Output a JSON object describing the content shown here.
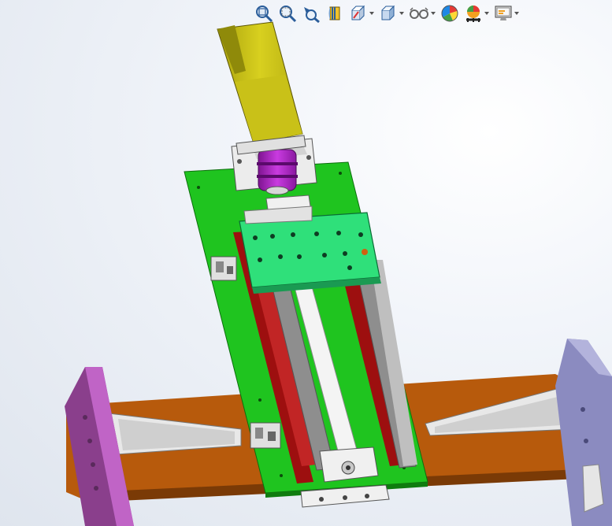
{
  "app": {
    "viewport_name": "graphics-area"
  },
  "toolbar": {
    "items": [
      {
        "icon": "zoom-to-fit-icon",
        "has_dropdown": false
      },
      {
        "icon": "zoom-to-area-icon",
        "has_dropdown": false
      },
      {
        "icon": "previous-view-icon",
        "has_dropdown": false
      },
      {
        "icon": "section-view-icon",
        "has_dropdown": false
      },
      {
        "icon": "view-orientation-icon",
        "has_dropdown": true
      },
      {
        "icon": "display-style-icon",
        "has_dropdown": true
      },
      {
        "icon": "hide-show-items-icon",
        "has_dropdown": true
      },
      {
        "icon": "edit-appearance-icon",
        "has_dropdown": false
      },
      {
        "icon": "apply-scene-icon",
        "has_dropdown": true
      },
      {
        "icon": "view-settings-icon",
        "has_dropdown": true
      }
    ]
  },
  "model": {
    "parts": [
      "motor",
      "motor-mount",
      "coupling",
      "base-plate",
      "carriage-plate",
      "guide-rails",
      "ball-screw",
      "support-bar",
      "left-end-bracket",
      "right-end-bracket",
      "gusset-left",
      "gusset-right"
    ],
    "colors": {
      "motor": "#d4cc1a",
      "coupling": "#b020c8",
      "base_plate": "#1fc41f",
      "carriage_plate": "#33e07c",
      "rail_red": "#a01010",
      "rail_gray": "#8e8e8e",
      "support_bar": "#b75a0c",
      "left_bracket": "#b64fba",
      "right_bracket": "#8f8fc4",
      "metal_white": "#e9e9e9"
    }
  }
}
